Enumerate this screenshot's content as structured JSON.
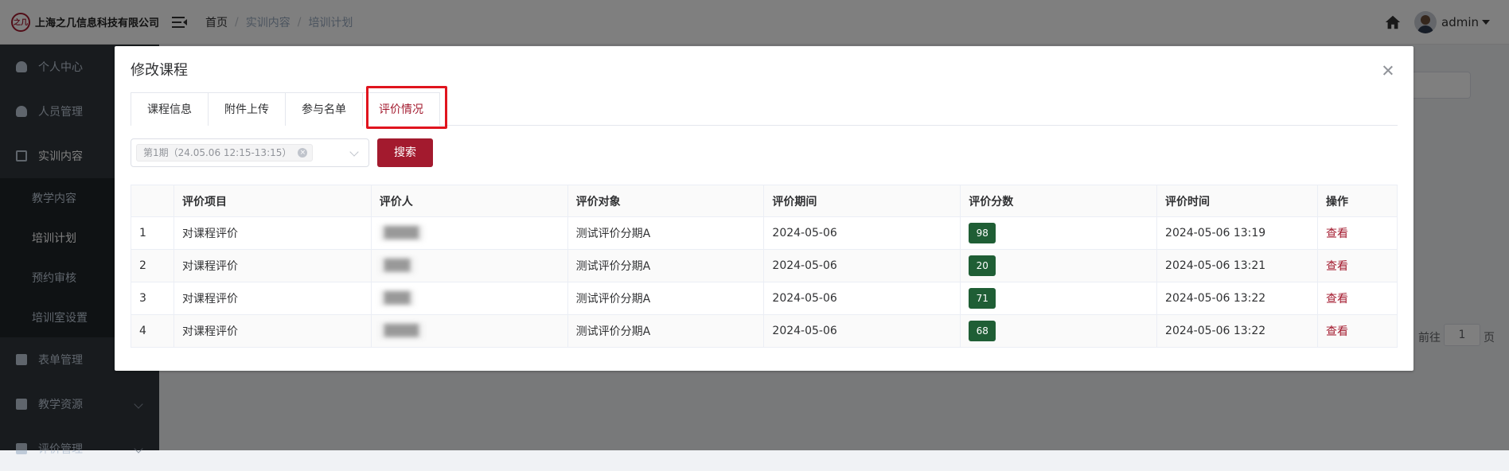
{
  "app": {
    "company_name": "上海之几信息科技有限公司",
    "logo_text": "之几",
    "username": "admin"
  },
  "breadcrumb": [
    "首页",
    "实训内容",
    "培训计划"
  ],
  "sidebar": {
    "items": [
      {
        "label": "个人中心",
        "icon": "user-icon"
      },
      {
        "label": "人员管理",
        "icon": "users-icon"
      },
      {
        "label": "实训内容",
        "icon": "document-icon"
      }
    ],
    "sub_items": [
      {
        "label": "教学内容",
        "active": false
      },
      {
        "label": "培训计划",
        "active": true
      },
      {
        "label": "预约审核",
        "active": false
      },
      {
        "label": "培训室设置",
        "active": false
      }
    ],
    "bottom_items": [
      {
        "label": "表单管理",
        "icon": "form-icon"
      },
      {
        "label": "教学资源",
        "icon": "book-icon"
      },
      {
        "label": "评价管理",
        "icon": "star-icon"
      }
    ]
  },
  "background": {
    "pagination_goto": "前往",
    "pagination_page": "1",
    "pagination_unit": "页"
  },
  "dialog": {
    "title": "修改课程",
    "tabs": [
      "课程信息",
      "附件上传",
      "参与名单",
      "评价情况"
    ],
    "active_tab": "评价情况",
    "filter_tag": "第1期（24.05.06 12:15-13:15）",
    "search_label": "搜索",
    "table": {
      "columns": [
        "",
        "评价项目",
        "评价人",
        "评价对象",
        "评价期间",
        "评价分数",
        "评价时间",
        "操作"
      ],
      "rows": [
        {
          "index": "1",
          "item": "对课程评价",
          "evaluator": "████",
          "target": "测试评价分期A",
          "period": "2024-05-06",
          "score": "98",
          "time": "2024-05-06 13:19",
          "action": "查看"
        },
        {
          "index": "2",
          "item": "对课程评价",
          "evaluator": "███",
          "target": "测试评价分期A",
          "period": "2024-05-06",
          "score": "20",
          "time": "2024-05-06 13:21",
          "action": "查看"
        },
        {
          "index": "3",
          "item": "对课程评价",
          "evaluator": "███",
          "target": "测试评价分期A",
          "period": "2024-05-06",
          "score": "71",
          "time": "2024-05-06 13:22",
          "action": "查看"
        },
        {
          "index": "4",
          "item": "对课程评价",
          "evaluator": "████",
          "target": "测试评价分期A",
          "period": "2024-05-06",
          "score": "68",
          "time": "2024-05-06 13:22",
          "action": "查看"
        }
      ]
    }
  },
  "colors": {
    "brand": "#a31a2e",
    "sidebar_bg": "#30363d",
    "score_badge": "#1f5e35",
    "highlight_box": "#e0141e"
  }
}
